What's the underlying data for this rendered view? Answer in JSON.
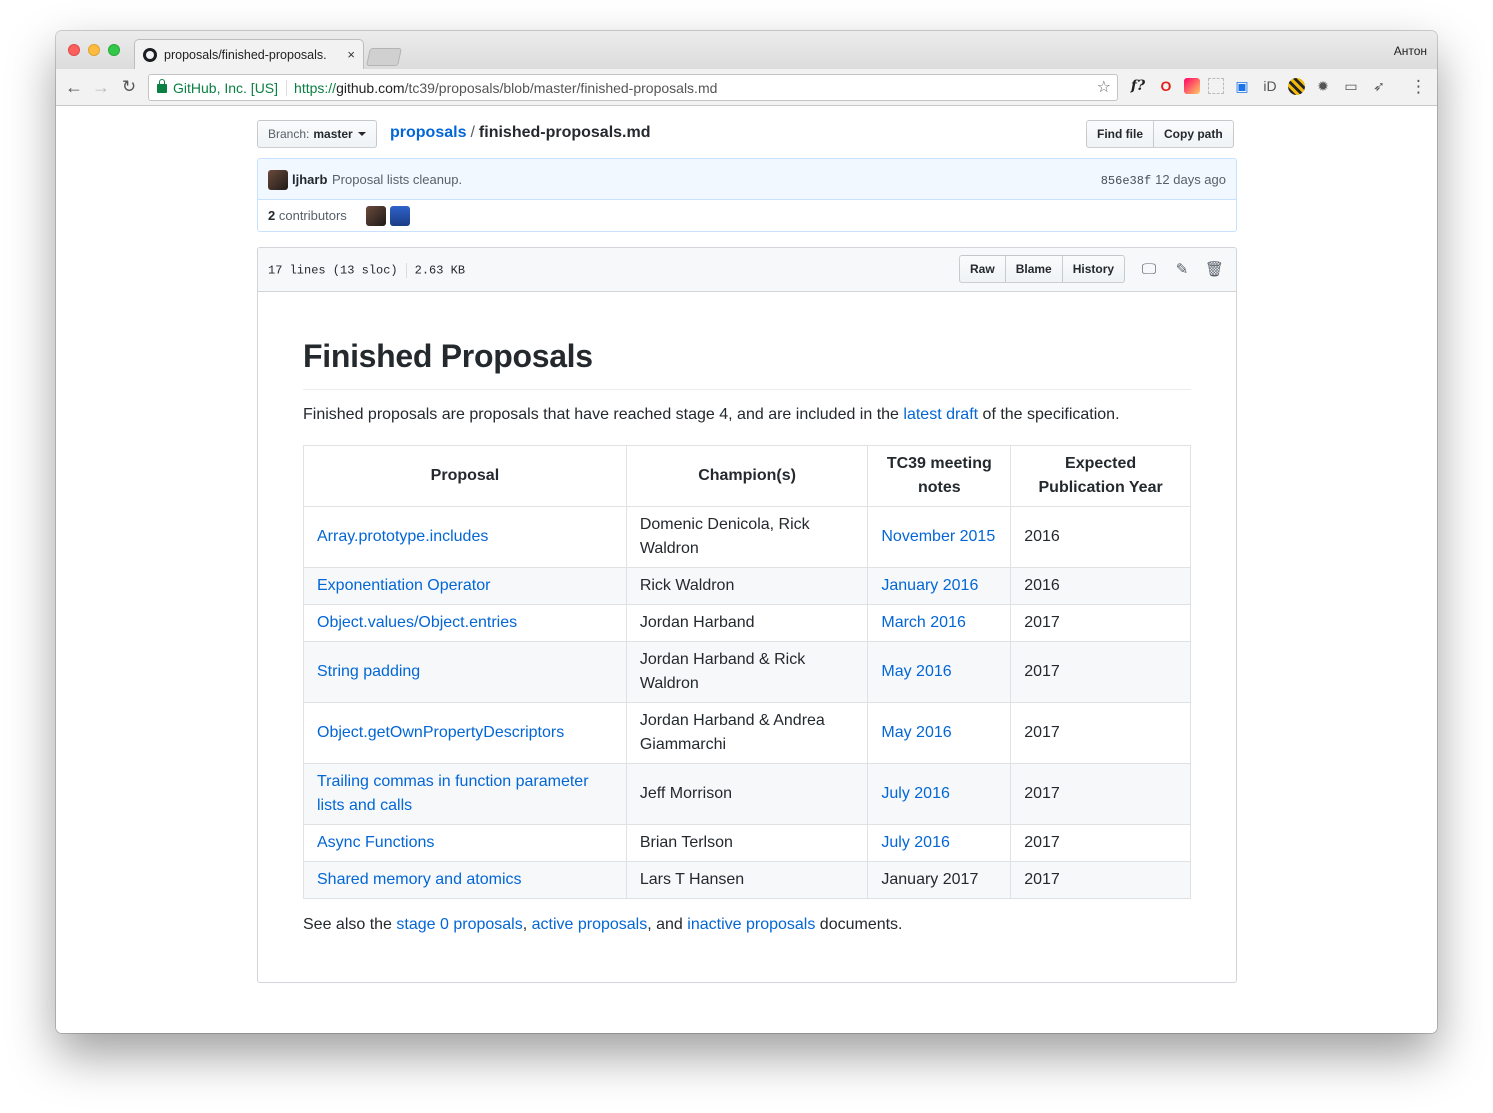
{
  "browser": {
    "tab_title": "proposals/finished-proposals.",
    "tab_close": "×",
    "profile_name": "Антон",
    "ev_label": "GitHub, Inc. [US]",
    "url_scheme": "https://",
    "url_host": "github.com",
    "url_path": "/tc39/proposals/blob/master/finished-proposals.md",
    "nav_back": "←",
    "nav_forward": "→",
    "nav_reload": "↻",
    "star": "☆",
    "menu": "⋮",
    "ext_f": "f?",
    "ext_opera": "O"
  },
  "header": {
    "branch_label": "Branch:",
    "branch_name": "master",
    "repo_name": "proposals",
    "path_sep": "/",
    "file_name": "finished-proposals.md",
    "find_file": "Find file",
    "copy_path": "Copy path"
  },
  "commit": {
    "author": "ljharb",
    "message": "Proposal lists cleanup.",
    "sha": "856e38f",
    "age": "12 days ago",
    "contributors_count": "2",
    "contributors_label": "contributors"
  },
  "file": {
    "lines_info": "17 lines (13 sloc)",
    "size": "2.63 KB",
    "raw": "Raw",
    "blame": "Blame",
    "history": "History"
  },
  "content": {
    "title": "Finished Proposals",
    "intro_before": "Finished proposals are proposals that have reached stage 4, and are included in the ",
    "intro_link": "latest draft",
    "intro_after": " of the specification.",
    "table_headers": [
      "Proposal",
      "Champion(s)",
      "TC39 meeting notes",
      "Expected Publication Year"
    ],
    "table_rows": [
      {
        "proposal": "Array.prototype.includes",
        "champions": "Domenic Denicola, Rick Waldron",
        "notes": "November 2015",
        "notes_link": true,
        "year": "2016"
      },
      {
        "proposal": "Exponentiation Operator",
        "champions": "Rick Waldron",
        "notes": "January 2016",
        "notes_link": true,
        "year": "2016"
      },
      {
        "proposal": "Object.values/Object.entries",
        "champions": "Jordan Harband",
        "notes": "March 2016",
        "notes_link": true,
        "year": "2017"
      },
      {
        "proposal": "String padding",
        "champions": "Jordan Harband & Rick Waldron",
        "notes": "May 2016",
        "notes_link": true,
        "year": "2017"
      },
      {
        "proposal": "Object.getOwnPropertyDescriptors",
        "champions": "Jordan Harband & Andrea Giammarchi",
        "notes": "May 2016",
        "notes_link": true,
        "year": "2017"
      },
      {
        "proposal": "Trailing commas in function parameter lists and calls",
        "champions": "Jeff Morrison",
        "notes": "July 2016",
        "notes_link": true,
        "year": "2017"
      },
      {
        "proposal": "Async Functions",
        "champions": "Brian Terlson",
        "notes": "July 2016",
        "notes_link": true,
        "year": "2017"
      },
      {
        "proposal": "Shared memory and atomics",
        "champions": "Lars T Hansen",
        "notes": "January 2017",
        "notes_link": false,
        "year": "2017"
      }
    ],
    "footer_before": "See also the ",
    "footer_link1": "stage 0 proposals",
    "footer_sep1": ", ",
    "footer_link2": "active proposals",
    "footer_sep2": ", and ",
    "footer_link3": "inactive proposals",
    "footer_after": " documents."
  },
  "colors": {
    "link": "#0366d6",
    "text": "#24292e",
    "commit_bg": "#f1f8ff",
    "ev_green": "#0b8043"
  }
}
